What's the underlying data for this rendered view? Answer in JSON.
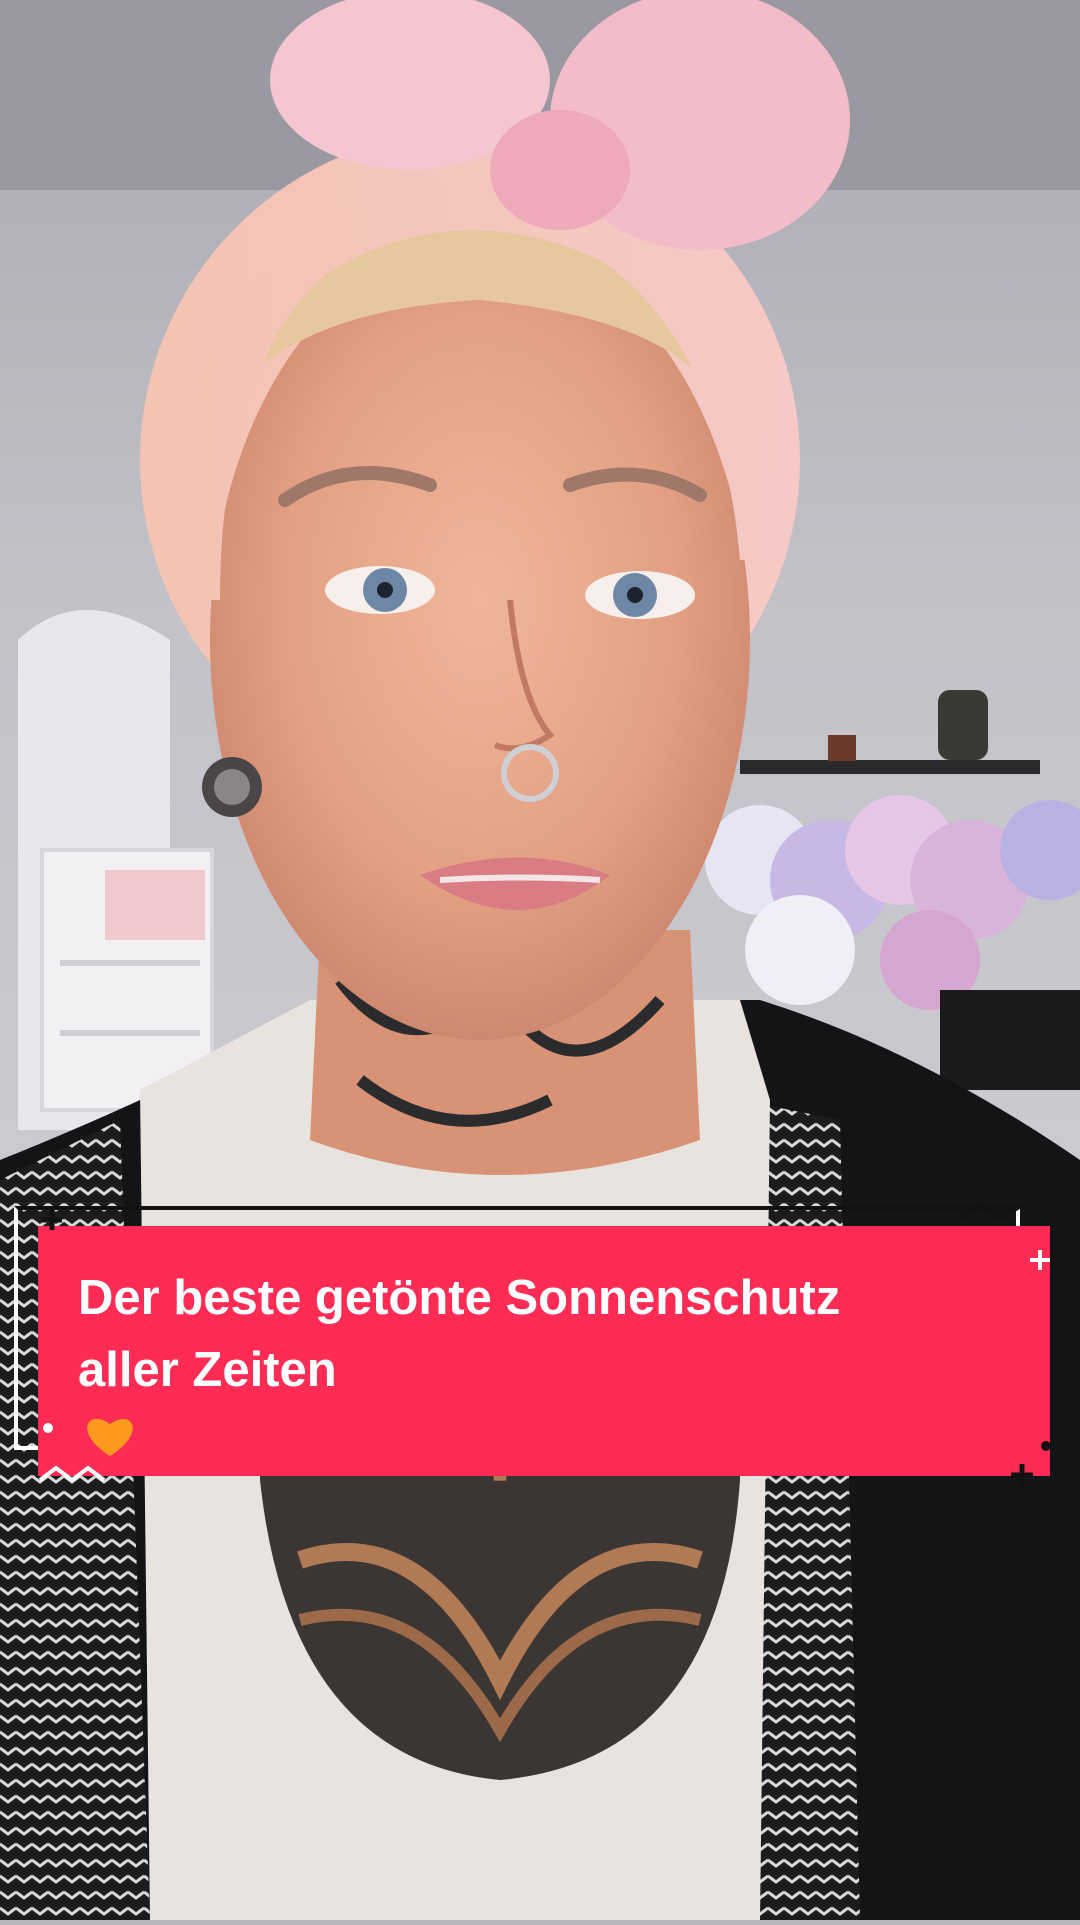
{
  "caption": {
    "line1": "Der beste getönte Sonnenschutz",
    "line2": "aller Zeiten",
    "emoji": "orange-heart-icon",
    "box_color": "#fe2c55",
    "text_color": "#ffffff"
  },
  "scene": {
    "subject": "person-selfie-video-frame"
  }
}
